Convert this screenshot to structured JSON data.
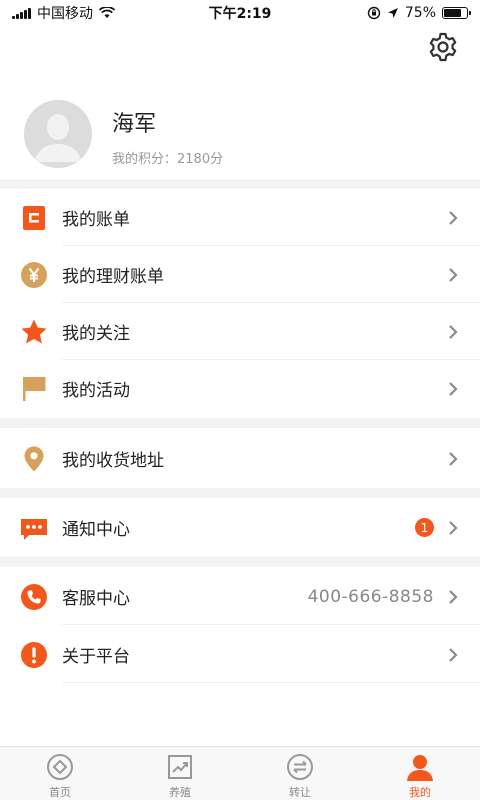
{
  "status_bar": {
    "carrier": "中国移动",
    "time": "下午2:19",
    "battery": "75%",
    "battery_level": 0.75
  },
  "profile": {
    "name": "海军",
    "points": "我的积分：2180分"
  },
  "menu_group1": [
    {
      "label": "我的账单",
      "icon": "bill-icon"
    },
    {
      "label": "我的理财账单",
      "icon": "yen-coin-icon"
    },
    {
      "label": "我的关注",
      "icon": "star-icon"
    },
    {
      "label": "我的活动",
      "icon": "flag-icon"
    }
  ],
  "menu_group2": [
    {
      "label": "我的收货地址",
      "icon": "location-pin-icon"
    }
  ],
  "menu_group3": [
    {
      "label": "通知中心",
      "icon": "message-icon",
      "badge": "1"
    }
  ],
  "menu_group4": [
    {
      "label": "客服中心",
      "icon": "phone-icon",
      "value": "400-666-8858"
    },
    {
      "label": "关于平台",
      "icon": "info-icon"
    }
  ],
  "tabbar": [
    {
      "label": "首页",
      "icon": "home-icon"
    },
    {
      "label": "养殖",
      "icon": "chart-icon"
    },
    {
      "label": "转让",
      "icon": "transfer-icon"
    },
    {
      "label": "我的",
      "icon": "person-icon",
      "active": true
    }
  ],
  "colors": {
    "accent": "#f2581c",
    "gold": "#d6a15a",
    "gray_text": "#999999"
  }
}
